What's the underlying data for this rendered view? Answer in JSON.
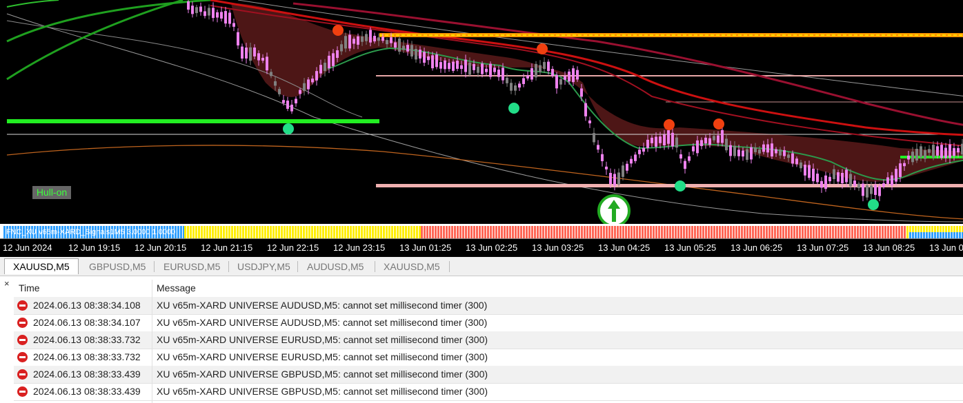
{
  "chart": {
    "hull_label": "Hull-on",
    "indicator_label": "FNC_XU v65m-XARD_Signals1M5 3.0000 1.0000",
    "time_labels": [
      "12 Jun 2024",
      "12 Jun 19:15",
      "12 Jun 20:15",
      "12 Jun 21:15",
      "12 Jun 22:15",
      "12 Jun 23:15",
      "13 Jun 01:25",
      "13 Jun 02:25",
      "13 Jun 03:25",
      "13 Jun 04:25",
      "13 Jun 05:25",
      "13 Jun 06:25",
      "13 Jun 07:25",
      "13 Jun 08:25",
      "13 Jun 0"
    ],
    "colors": {
      "background": "#000000",
      "bull_candle": "#808080",
      "bear_candle": "#ee82ee",
      "band_red": "#cc0000",
      "band_green": "#22cc22",
      "signal_yellow": "#ffee00",
      "signal_red": "#ff6655",
      "signal_blue": "#2f9fff"
    }
  },
  "tabs": [
    "XAUUSD,M5",
    "GBPUSD,M5",
    "EURUSD,M5",
    "USDJPY,M5",
    "AUDUSD,M5",
    "XAUUSD,M5"
  ],
  "active_tab": 0,
  "log": {
    "close_glyph": "×",
    "columns": {
      "time": "Time",
      "message": "Message"
    },
    "rows": [
      {
        "time": "2024.06.13 08:38:34.108",
        "message": "XU v65m-XARD UNIVERSE AUDUSD,M5: cannot set millisecond timer (300)"
      },
      {
        "time": "2024.06.13 08:38:34.107",
        "message": "XU v65m-XARD UNIVERSE AUDUSD,M5: cannot set millisecond timer (300)"
      },
      {
        "time": "2024.06.13 08:38:33.732",
        "message": "XU v65m-XARD UNIVERSE EURUSD,M5: cannot set millisecond timer (300)"
      },
      {
        "time": "2024.06.13 08:38:33.732",
        "message": "XU v65m-XARD UNIVERSE EURUSD,M5: cannot set millisecond timer (300)"
      },
      {
        "time": "2024.06.13 08:38:33.439",
        "message": "XU v65m-XARD UNIVERSE GBPUSD,M5: cannot set millisecond timer (300)"
      },
      {
        "time": "2024.06.13 08:38:33.439",
        "message": "XU v65m-XARD UNIVERSE GBPUSD,M5: cannot set millisecond timer (300)"
      }
    ]
  }
}
